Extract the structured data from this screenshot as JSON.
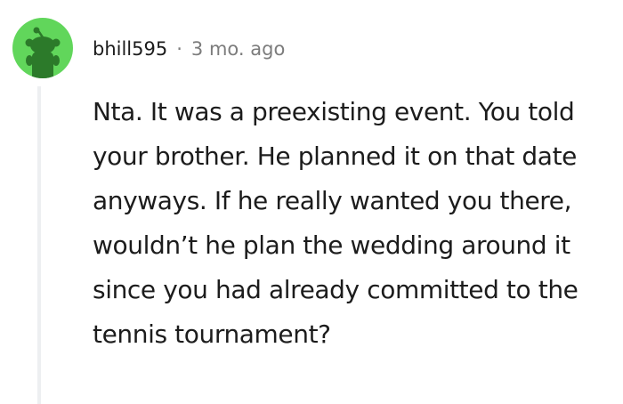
{
  "comment": {
    "username": "bhill595",
    "separator": "·",
    "timestamp": "3 mo. ago",
    "body": "Nta. It was a preexisting event. You told your brother. He planned it on that date anyways. If he really wanted you there, wouldn’t he plan the wedding around it since you had already committed to the tennis tournament?"
  },
  "icons": {
    "avatar": "reddit-snoo-avatar-icon"
  },
  "colors": {
    "avatar_background": "#61d65b",
    "avatar_figure": "#2c7a2a",
    "text": "#1c1c1c",
    "meta_text": "#7c7c7c",
    "thread_line": "#edeff1"
  }
}
